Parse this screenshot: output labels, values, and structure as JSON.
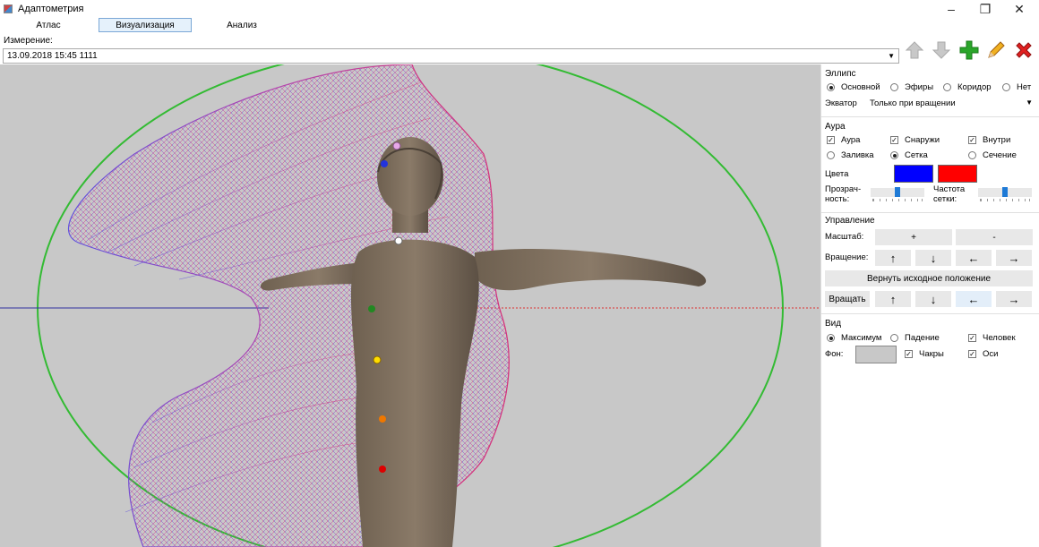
{
  "window": {
    "title": "Адаптометрия"
  },
  "tabs": [
    "Атлас",
    "Визуализация",
    "Анализ"
  ],
  "measurement": {
    "label": "Измерение:",
    "value": "13.09.2018 15:45 1111"
  },
  "toolbar": {
    "icons": [
      "arrow-up-icon",
      "arrow-down-icon",
      "plus-icon",
      "pencil-icon",
      "delete-icon"
    ],
    "colors": {
      "plus": "#2aa52a",
      "pencil": "#f0a020",
      "delete": "#e02020",
      "disabled": "#b8b8b8"
    }
  },
  "ellipse": {
    "title": "Эллипс",
    "options": [
      "Основной",
      "Эфиры",
      "Коридор",
      "Нет"
    ],
    "selected": "Основной",
    "equator_label": "Экватор",
    "equator_value": "Только при вращении"
  },
  "aura": {
    "title": "Аура",
    "checks": [
      "Аура",
      "Снаружи",
      "Внутри"
    ],
    "radios": [
      "Заливка",
      "Сетка",
      "Сечение"
    ],
    "radio_selected": "Сетка",
    "colors_label": "Цвета",
    "color1": "#0000ff",
    "color2": "#ff0000",
    "transparency_label_1": "Прозрач-",
    "transparency_label_2": "ность:",
    "grid_freq_label_1": "Частота",
    "grid_freq_label_2": "сетки:"
  },
  "control": {
    "title": "Управление",
    "scale_label": "Масштаб:",
    "scale_plus": "+",
    "scale_minus": "-",
    "rotation_label": "Вращение:",
    "reset_label": "Вернуть исходное положение",
    "rotate_label": "Вращать",
    "arrows": [
      "↑",
      "↓",
      "←",
      "→"
    ]
  },
  "view": {
    "title": "Вид",
    "radios": [
      "Максимум",
      "Падение"
    ],
    "radio_selected": "Максимум",
    "human_label": "Человек",
    "bg_label": "Фон:",
    "chakras_label": "Чакры",
    "axes_label": "Оси",
    "bg_color": "#c8c8c8"
  },
  "scene": {
    "background": "#c8c8c8",
    "ellipse_color": "#33bb33",
    "chakra_colors": [
      "#e8a8e8",
      "#2233dd",
      "#ffffff",
      "#228822",
      "#ffdd00",
      "#ee7700",
      "#dd0000"
    ]
  }
}
